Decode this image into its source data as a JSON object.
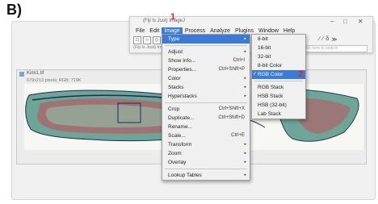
{
  "panel_label": "B)",
  "main_window": {
    "title": "(Fiji Is Just) ImageJ",
    "menus": [
      "File",
      "Edit",
      "Image",
      "Process",
      "Analyze",
      "Plugins",
      "Window",
      "Help"
    ],
    "status": "(Fiji Is Just) ImageJ",
    "search_placeholder": "Click here to search",
    "window_controls": [
      "–",
      "□",
      "✕"
    ]
  },
  "image_window": {
    "title": "Kimi1.tif",
    "info": "679x213 pixels; RGB; 719K"
  },
  "image_menu": {
    "items": [
      {
        "label": "Type",
        "submenu": true,
        "highlight": true
      },
      {
        "sep": true
      },
      {
        "label": "Adjust",
        "submenu": true
      },
      {
        "label": "Show Info...",
        "shortcut": "Ctrl+I"
      },
      {
        "label": "Properties...",
        "shortcut": "Ctrl+Shift+P"
      },
      {
        "label": "Color",
        "submenu": true
      },
      {
        "label": "Stacks",
        "submenu": true
      },
      {
        "label": "Hyperstacks",
        "submenu": true
      },
      {
        "sep": true
      },
      {
        "label": "Crop",
        "shortcut": "Ctrl+Shift+X"
      },
      {
        "label": "Duplicate...",
        "shortcut": "Ctrl+Shift+D"
      },
      {
        "label": "Rename..."
      },
      {
        "label": "Scale...",
        "shortcut": "Ctrl+E"
      },
      {
        "label": "Transform",
        "submenu": true
      },
      {
        "label": "Zoom",
        "submenu": true
      },
      {
        "label": "Overlay",
        "submenu": true
      },
      {
        "sep": true
      },
      {
        "label": "Lookup Tables",
        "submenu": true
      }
    ]
  },
  "type_submenu": {
    "items": [
      {
        "label": "8-bit"
      },
      {
        "label": "16-bit"
      },
      {
        "label": "32-bit"
      },
      {
        "label": "8-bit Color"
      },
      {
        "label": "RGB Color",
        "checked": true,
        "highlight": true
      },
      {
        "sep": true
      },
      {
        "label": "RGB Stack"
      },
      {
        "label": "HSB Stack"
      },
      {
        "label": "HSB (32-bit)"
      },
      {
        "label": "Lab Stack"
      }
    ]
  },
  "annotations": {
    "step1": "1",
    "step2": "2"
  },
  "colors": {
    "highlight": "#3b7bd6",
    "marker": "#e0212e",
    "tissue_green": "#5f9e8a",
    "tissue_red": "#c94a5a"
  }
}
